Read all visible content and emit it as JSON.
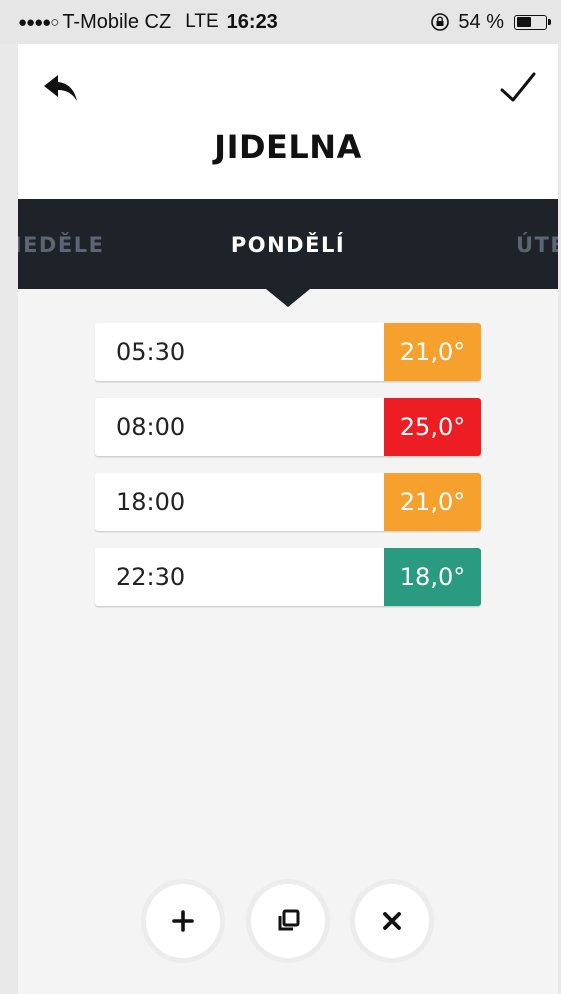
{
  "status_bar": {
    "signal": "●●●●○",
    "carrier": "T-Mobile CZ",
    "network": "LTE",
    "time": "16:23",
    "battery": "54 %",
    "battery_level_percent": 54
  },
  "header": {
    "title": "JIDELNA",
    "back_icon": "reply-arrow-icon",
    "confirm_icon": "checkmark-icon"
  },
  "day_selector": {
    "previous": "NEDĚLE",
    "current": "PONDĚLÍ",
    "next": "ÚTERÝ"
  },
  "schedule": [
    {
      "time": "05:30",
      "temp": "21,0°",
      "color": "#f6a02d"
    },
    {
      "time": "08:00",
      "temp": "25,0°",
      "color": "#ed1d24"
    },
    {
      "time": "18:00",
      "temp": "21,0°",
      "color": "#f6a02d"
    },
    {
      "time": "22:30",
      "temp": "18,0°",
      "color": "#2a9a81"
    }
  ],
  "actions": {
    "add_icon": "plus-icon",
    "copy_icon": "copy-icon",
    "delete_icon": "close-icon"
  }
}
